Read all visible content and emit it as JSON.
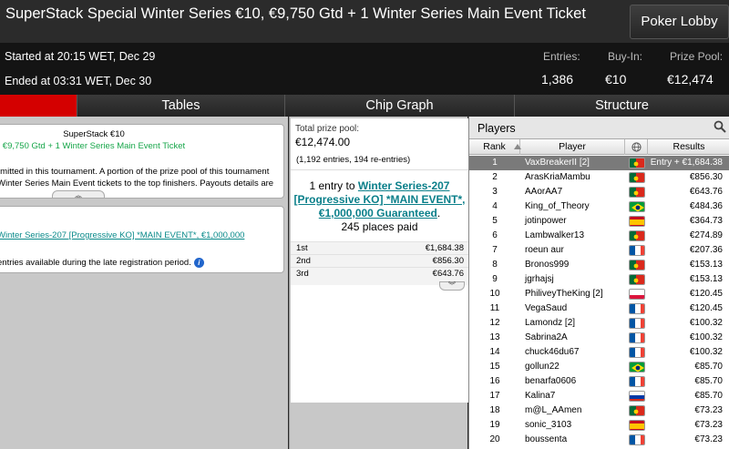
{
  "window": {
    "title": "SuperStack Special Winter Series €10, €9,750 Gtd + 1 Winter Series Main Event Ticket",
    "lobby_button": "Poker Lobby"
  },
  "info": {
    "started": "Started at 20:15 WET, Dec 29",
    "ended": "Ended at 03:31 WET, Dec 30",
    "entries_label": "Entries:",
    "entries_value": "1,386",
    "buyin_label": "Buy-In:",
    "buyin_value": "€10",
    "prize_label": "Prize Pool:",
    "prize_value": "€12,474"
  },
  "tabs": [
    "Tables",
    "Chip Graph",
    "Structure"
  ],
  "left": {
    "card1_title": "SuperStack €10",
    "card1_subtitle": "€9,750 Gtd + 1 Winter Series Main Event Ticket",
    "card1_text_line1": "rmitted in this tournament. A portion of the prize pool of this tournament",
    "card1_text_line2": "Winter Series Main Event tickets to the top finishers. Payouts details are",
    "card2_link": "Winter Series-207 [Progressive KO] *MAIN EVENT*, €1,000,000",
    "card2_text": "entries available during the late registration period."
  },
  "prize": {
    "total_label": "Total prize pool:",
    "total_value": "€12,474.00",
    "entries_note": "(1,192 entries, 194 re-entries)",
    "entry_prefix": "1 entry to ",
    "entry_link": "Winter Series-207 [Progressive KO] *MAIN EVENT*, €1,000,000 Guaranteed",
    "entry_suffix": ".",
    "places_paid": "245 places paid",
    "payouts": [
      {
        "place": "1st",
        "amount": "€1,684.38"
      },
      {
        "place": "2nd",
        "amount": "€856.30"
      },
      {
        "place": "3rd",
        "amount": "€643.76"
      }
    ]
  },
  "players": {
    "title": "Players",
    "col_rank": "Rank",
    "col_player": "Player",
    "col_results": "Results",
    "colors": {
      "selected_row": "#7a7a7a",
      "red_tab": "#d40000",
      "link": "#0a7f8a",
      "green_text": "#17a64a"
    },
    "rows": [
      {
        "rank": "1",
        "name": "VaxBreakerII [2]",
        "flag": "pt",
        "result": "Entry + €1,684.38"
      },
      {
        "rank": "2",
        "name": "ArasKriaMambu",
        "flag": "pt",
        "result": "€856.30"
      },
      {
        "rank": "3",
        "name": "AAorAA7",
        "flag": "pt",
        "result": "€643.76"
      },
      {
        "rank": "4",
        "name": "King_of_Theory",
        "flag": "br",
        "result": "€484.36"
      },
      {
        "rank": "5",
        "name": "jotinpower",
        "flag": "es",
        "result": "€364.73"
      },
      {
        "rank": "6",
        "name": "Lambwalker13",
        "flag": "pt",
        "result": "€274.89"
      },
      {
        "rank": "7",
        "name": "roeun aur",
        "flag": "fr",
        "result": "€207.36"
      },
      {
        "rank": "8",
        "name": "Bronos999",
        "flag": "pt",
        "result": "€153.13"
      },
      {
        "rank": "9",
        "name": "jgrhajsj",
        "flag": "pt",
        "result": "€153.13"
      },
      {
        "rank": "10",
        "name": "PhiliveyTheKing [2]",
        "flag": "pl",
        "result": "€120.45"
      },
      {
        "rank": "11",
        "name": "VegaSaud",
        "flag": "fr",
        "result": "€120.45"
      },
      {
        "rank": "12",
        "name": "Lamondz [2]",
        "flag": "fr",
        "result": "€100.32"
      },
      {
        "rank": "13",
        "name": "Sabrina2A",
        "flag": "fr",
        "result": "€100.32"
      },
      {
        "rank": "14",
        "name": "chuck46du67",
        "flag": "fr",
        "result": "€100.32"
      },
      {
        "rank": "15",
        "name": "gollun22",
        "flag": "br",
        "result": "€85.70"
      },
      {
        "rank": "16",
        "name": "benarfa0606",
        "flag": "fr",
        "result": "€85.70"
      },
      {
        "rank": "17",
        "name": "Kalina7",
        "flag": "ru",
        "result": "€85.70"
      },
      {
        "rank": "18",
        "name": "m@L_AAmen",
        "flag": "pt",
        "result": "€73.23"
      },
      {
        "rank": "19",
        "name": "sonic_3103",
        "flag": "es",
        "result": "€73.23"
      },
      {
        "rank": "20",
        "name": "boussenta",
        "flag": "fr",
        "result": "€73.23"
      }
    ]
  }
}
